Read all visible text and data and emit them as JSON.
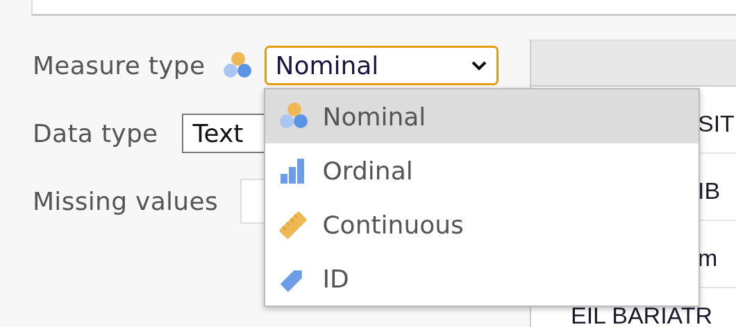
{
  "measure_type": {
    "label": "Measure type",
    "value": "Nominal",
    "kind": "nominal",
    "open": true,
    "options": [
      {
        "label": "Nominal",
        "kind": "nominal",
        "selected": true
      },
      {
        "label": "Ordinal",
        "kind": "ordinal",
        "selected": false
      },
      {
        "label": "Continuous",
        "kind": "continuous",
        "selected": false
      },
      {
        "label": "ID",
        "kind": "id",
        "selected": false
      }
    ]
  },
  "data_type": {
    "label": "Data type",
    "value": "Text"
  },
  "missing_values": {
    "label": "Missing values"
  },
  "variable_list": {
    "rows": [
      {
        "text": "SIT"
      },
      {
        "text": "IB"
      },
      {
        "text": "m"
      },
      {
        "text": "EIL BARIATR"
      }
    ]
  }
}
